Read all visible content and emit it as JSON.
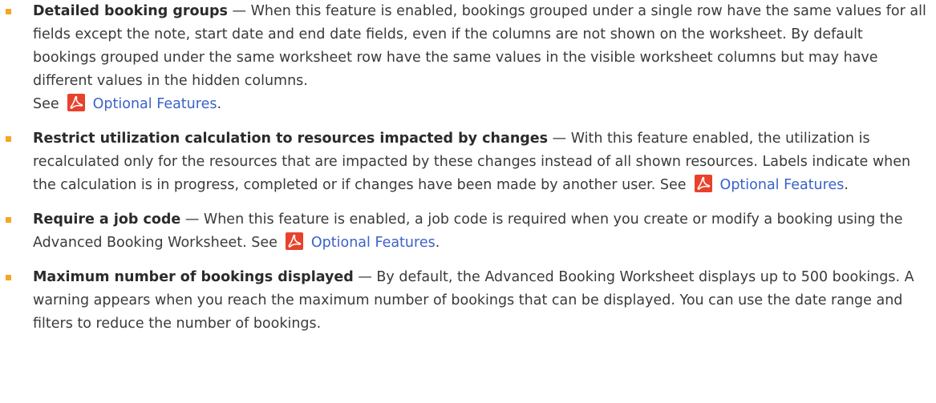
{
  "items": [
    {
      "term": "Detailed booking groups",
      "dash": " — ",
      "text": "When this feature is enabled, bookings grouped under a single row have the same values for all fields except the note, start date and end date fields, even if the columns are not shown on the worksheet. By default bookings grouped under the same worksheet row have the same values in the visible worksheet columns but may have different values in the hidden columns.",
      "see": "See",
      "link": "Optional Features",
      "after": "."
    },
    {
      "term": "Restrict utilization calculation to resources impacted by changes",
      "dash": " — ",
      "text": "With this feature enabled, the utilization is recalculated only for the resources that are impacted by these changes instead of all shown resources. Labels indicate when the calculation is in progress, completed or if changes have been made by another user.",
      "see": "See",
      "link": "Optional Features",
      "after": "."
    },
    {
      "term": "Require a job code",
      "dash": " — ",
      "text": "When this feature is enabled, a job code is required when you create or modify a booking using the Advanced Booking Worksheet.",
      "see": "See",
      "link": "Optional Features",
      "after": "."
    },
    {
      "term": "Maximum number of bookings displayed",
      "dash": " — ",
      "text": "By default, the Advanced Booking Worksheet displays up to 500 bookings. A warning appears when you reach the maximum number of bookings that can be displayed. You can use the date range and filters to reduce the number of bookings."
    }
  ],
  "colors": {
    "bullet": "#f5a623",
    "link": "#3b62c9",
    "pdf_icon": "#e8412c"
  },
  "icons": {
    "pdf": "pdf-icon"
  }
}
